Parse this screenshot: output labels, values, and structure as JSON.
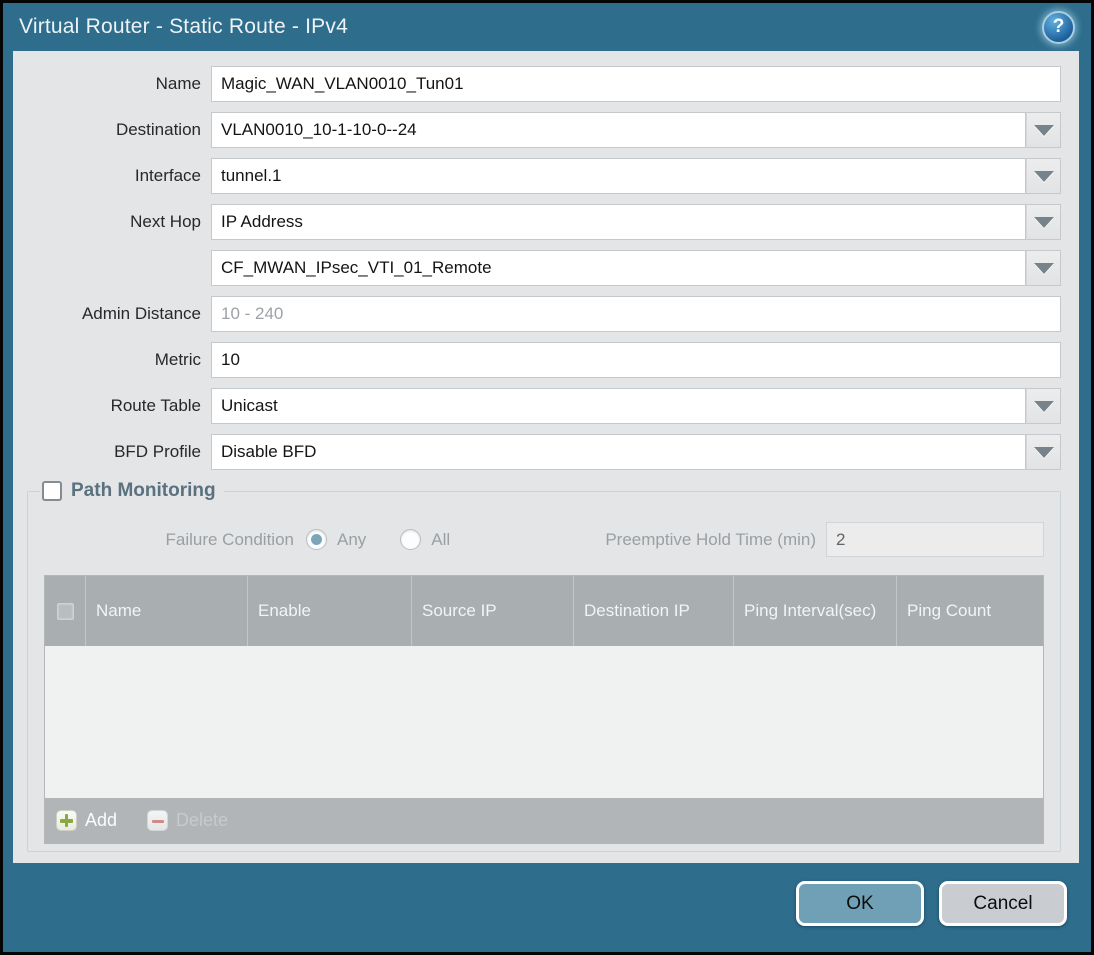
{
  "dialog": {
    "title": "Virtual Router - Static Route - IPv4",
    "help_icon": "?"
  },
  "form": {
    "name": {
      "label": "Name",
      "value": "Magic_WAN_VLAN0010_Tun01"
    },
    "destination": {
      "label": "Destination",
      "value": "VLAN0010_10-1-10-0--24"
    },
    "interface": {
      "label": "Interface",
      "value": "tunnel.1"
    },
    "next_hop": {
      "label": "Next Hop",
      "value": "IP Address"
    },
    "next_hop_address": {
      "value": "CF_MWAN_IPsec_VTI_01_Remote"
    },
    "admin_distance": {
      "label": "Admin Distance",
      "placeholder": "10 - 240",
      "value": ""
    },
    "metric": {
      "label": "Metric",
      "value": "10"
    },
    "route_table": {
      "label": "Route Table",
      "value": "Unicast"
    },
    "bfd_profile": {
      "label": "BFD Profile",
      "value": "Disable BFD"
    }
  },
  "path_monitoring": {
    "title": "Path Monitoring",
    "enabled": false,
    "failure_condition": {
      "label": "Failure Condition",
      "options": [
        {
          "label": "Any",
          "selected": true
        },
        {
          "label": "All",
          "selected": false
        }
      ]
    },
    "preemptive_hold_time": {
      "label": "Preemptive Hold Time (min)",
      "value": "2"
    },
    "table": {
      "columns": [
        "Name",
        "Enable",
        "Source IP",
        "Destination IP",
        "Ping Interval(sec)",
        "Ping Count"
      ],
      "rows": []
    },
    "add_label": "Add",
    "delete_label": "Delete"
  },
  "footer": {
    "ok_label": "OK",
    "cancel_label": "Cancel"
  },
  "colors": {
    "titlebar": "#2e6d8c",
    "body_bg": "#e4e5e6",
    "table_header_bg": "#a9aeb1",
    "ok_button": "#6fa0b6",
    "cancel_button": "#c9cdd1",
    "add_icon_green": "#8aa93f",
    "delete_icon_red": "#cf8a8a",
    "radio_selected": "#7ca6b7"
  }
}
